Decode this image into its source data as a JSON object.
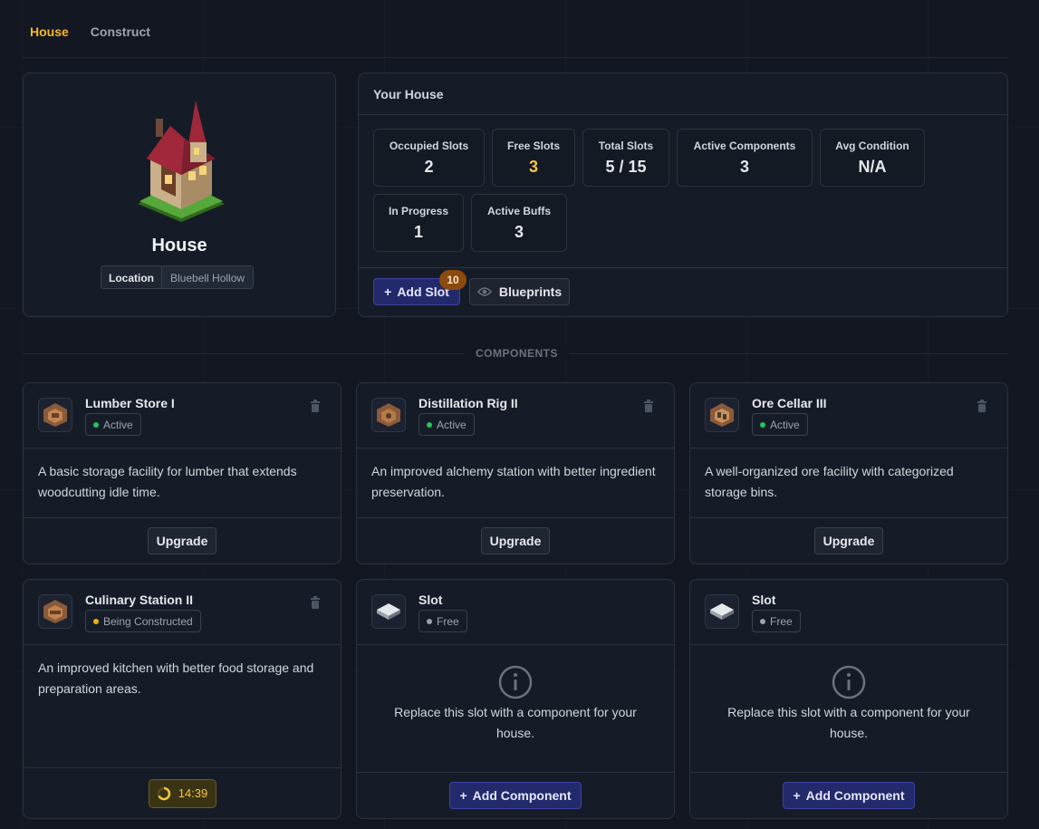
{
  "tabs": [
    {
      "label": "House",
      "active": true
    },
    {
      "label": "Construct",
      "active": false
    }
  ],
  "house": {
    "name": "House",
    "location_label": "Location",
    "location_value": "Bluebell Hollow"
  },
  "your_house": {
    "title": "Your House",
    "stats": [
      {
        "label": "Occupied Slots",
        "value": "2"
      },
      {
        "label": "Free Slots",
        "value": "3"
      },
      {
        "label": "Total Slots",
        "value": "5 / 15"
      },
      {
        "label": "Active Components",
        "value": "3"
      },
      {
        "label": "Avg Condition",
        "value": "N/A"
      },
      {
        "label": "In Progress",
        "value": "1"
      },
      {
        "label": "Active Buffs",
        "value": "3"
      }
    ],
    "add_slot_label": "Add Slot",
    "add_slot_badge": "10",
    "blueprints_label": "Blueprints"
  },
  "components_heading": "COMPONENTS",
  "components": [
    {
      "title": "Lumber Store I",
      "status": "Active",
      "description": "A basic storage facility for lumber that extends woodcutting idle time.",
      "action": "Upgrade"
    },
    {
      "title": "Distillation Rig II",
      "status": "Active",
      "description": "An improved alchemy station with better ingredient preservation.",
      "action": "Upgrade"
    },
    {
      "title": "Ore Cellar III",
      "status": "Active",
      "description": "A well-organized ore facility with categorized storage bins.",
      "action": "Upgrade"
    },
    {
      "title": "Culinary Station II",
      "status": "Being Constructed",
      "description": "An improved kitchen with better food storage and preparation areas.",
      "timer": "14:39"
    },
    {
      "title": "Slot",
      "status": "Free",
      "description": "Replace this slot with a component for your house.",
      "action": "Add Component"
    },
    {
      "title": "Slot",
      "status": "Free",
      "description": "Replace this slot with a component for your house.",
      "action": "Add Component"
    }
  ],
  "colors": {
    "accent_gold": "#f5b72a",
    "active_green": "#22c55e",
    "constructing_yellow": "#eab308",
    "free_gray": "#9ca3af",
    "primary_indigo": "#232a6b"
  }
}
